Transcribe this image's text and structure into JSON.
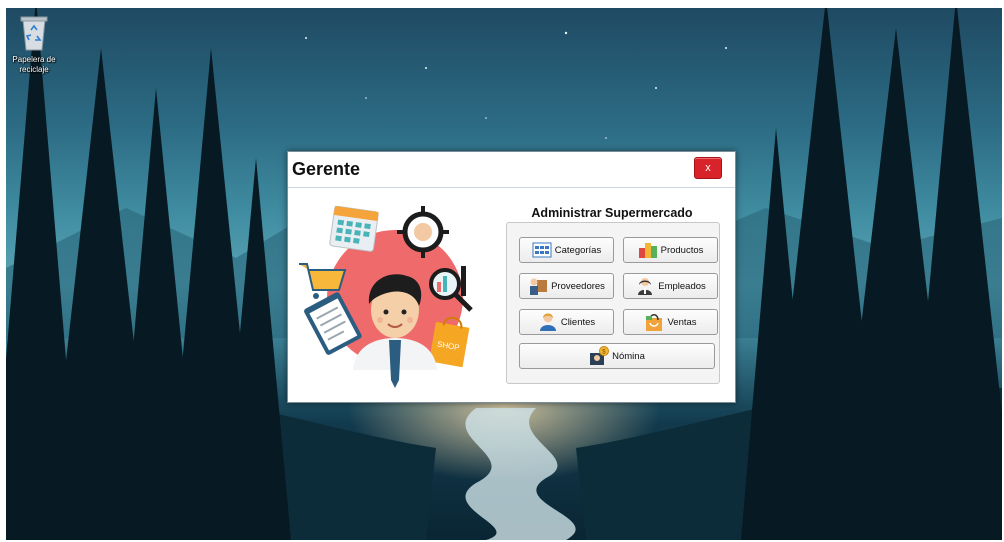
{
  "desktop": {
    "icons": [
      {
        "label_line1": "Papelera de",
        "label_line2": "reciclaje",
        "icon": "recycle-bin-icon"
      }
    ]
  },
  "window": {
    "title": "Gerente",
    "close_label": "x",
    "panel_title": "Administrar Supermercado",
    "illustration_shop_text": "SHOP",
    "buttons": [
      {
        "label": "Categorías",
        "icon": "grid-icon"
      },
      {
        "label": "Productos",
        "icon": "products-icon"
      },
      {
        "label": "Proveedores",
        "icon": "suppliers-icon"
      },
      {
        "label": "Empleados",
        "icon": "employee-icon"
      },
      {
        "label": "Clientes",
        "icon": "customer-icon"
      },
      {
        "label": "Ventas",
        "icon": "shopping-bag-icon"
      },
      {
        "label": "Nómina",
        "icon": "payroll-icon"
      }
    ]
  },
  "colors": {
    "close_button": "#d8232a",
    "illustration_circle": "#ef6a6a"
  }
}
